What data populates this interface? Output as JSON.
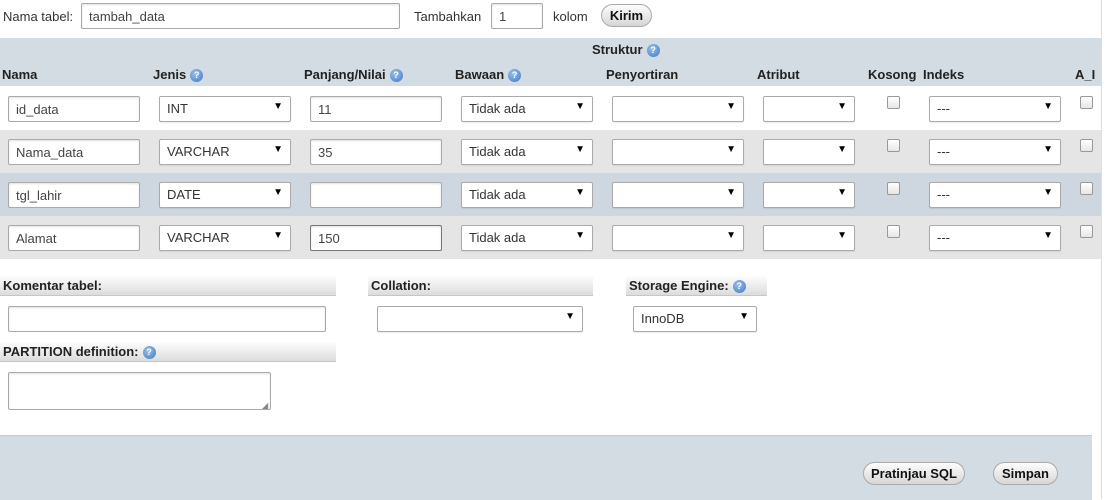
{
  "top": {
    "table_name_label": "Nama tabel:",
    "table_name_value": "tambah_data",
    "add_label": "Tambahkan",
    "add_count": "1",
    "column_unit": "kolom",
    "send_button": "Kirim"
  },
  "structure": {
    "title": "Struktur",
    "headers": {
      "name": "Nama",
      "type": "Jenis",
      "length": "Panjang/Nilai",
      "default": "Bawaan",
      "collation": "Penyortiran",
      "attribute": "Atribut",
      "null": "Kosong",
      "index": "Indeks",
      "ai": "A_I"
    },
    "rows": [
      {
        "name": "id_data",
        "type": "INT",
        "length": "11",
        "default": "Tidak ada",
        "collation": "",
        "attribute": "",
        "index": "---"
      },
      {
        "name": "Nama_data",
        "type": "VARCHAR",
        "length": "35",
        "default": "Tidak ada",
        "collation": "",
        "attribute": "",
        "index": "---"
      },
      {
        "name": "tgl_lahir",
        "type": "DATE",
        "length": "",
        "default": "Tidak ada",
        "collation": "",
        "attribute": "",
        "index": "---"
      },
      {
        "name": "Alamat",
        "type": "VARCHAR",
        "length": "150",
        "default": "Tidak ada",
        "collation": "",
        "attribute": "",
        "index": "---"
      }
    ]
  },
  "options": {
    "comment_label": "Komentar tabel:",
    "comment_value": "",
    "collation_label": "Collation:",
    "collation_value": "",
    "engine_label": "Storage Engine:",
    "engine_value": "InnoDB",
    "partition_label": "PARTITION definition:",
    "partition_value": ""
  },
  "footer": {
    "preview_button": "Pratinjau SQL",
    "save_button": "Simpan"
  },
  "colors": {
    "header_band": "#d3dce3",
    "row_even": "#e5e5e5",
    "row_hover": "#ced6df",
    "footer_band": "#d3dce3"
  }
}
